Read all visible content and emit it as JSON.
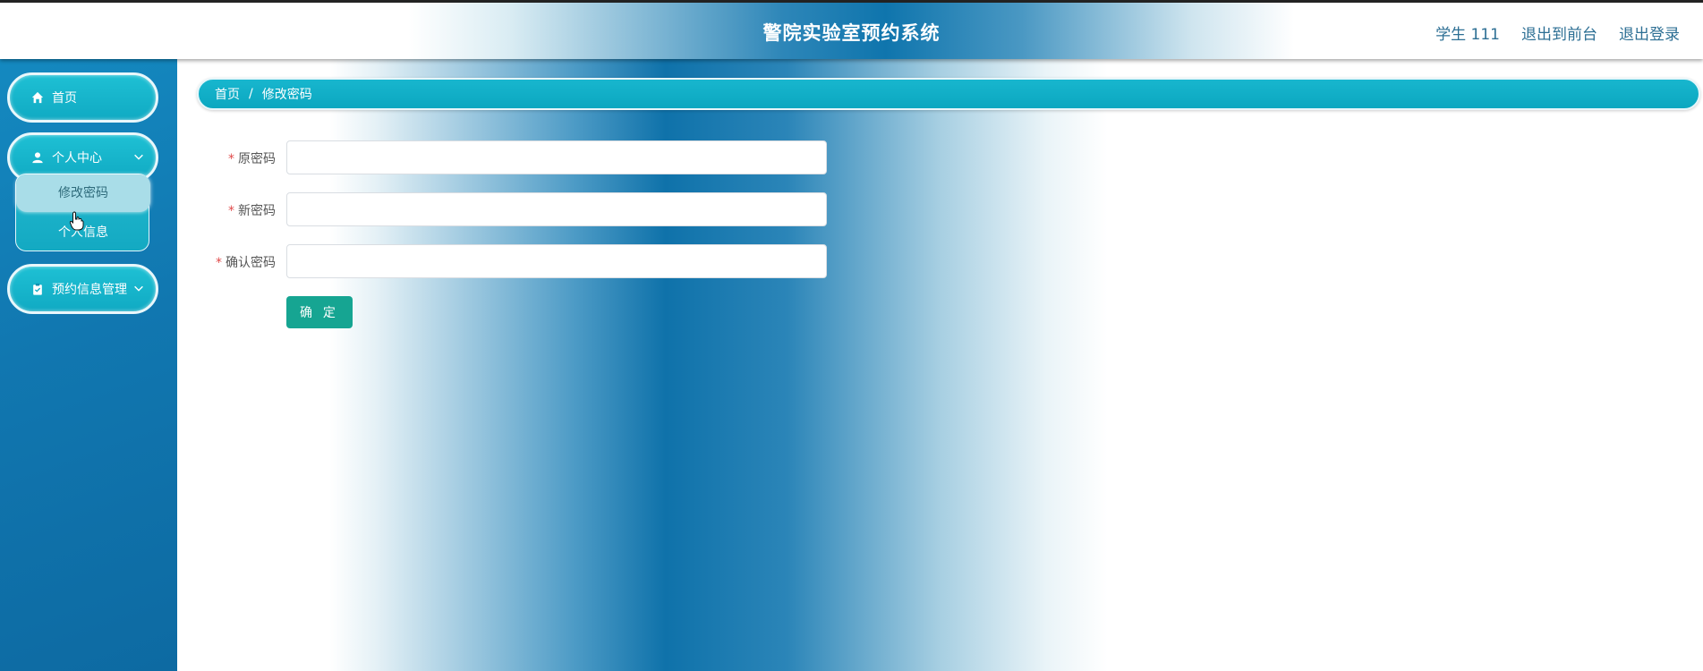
{
  "header": {
    "title": "警院实验室预约系统",
    "links": [
      "学生 111",
      "退出到前台",
      "退出登录"
    ]
  },
  "sidebar": {
    "items": [
      {
        "label": "首页",
        "icon": "home-icon"
      },
      {
        "label": "个人中心",
        "icon": "user-icon",
        "expanded": true,
        "children": [
          {
            "label": "修改密码",
            "active": true
          },
          {
            "label": "个人信息"
          }
        ]
      },
      {
        "label": "预约信息管理",
        "icon": "clipboard-icon",
        "expanded": false
      }
    ]
  },
  "breadcrumb": {
    "home": "首页",
    "separator": "/",
    "current": "修改密码"
  },
  "form": {
    "required_mark": "*",
    "fields": [
      {
        "label": "原密码",
        "value": "",
        "placeholder": ""
      },
      {
        "label": "新密码",
        "value": "",
        "placeholder": ""
      },
      {
        "label": "确认密码",
        "value": "",
        "placeholder": ""
      }
    ],
    "submit_label": "确 定"
  },
  "colors": {
    "accent": "#10aac3",
    "sidebar": "#1177b0",
    "submit": "#16a592",
    "required": "#e04a4a"
  }
}
